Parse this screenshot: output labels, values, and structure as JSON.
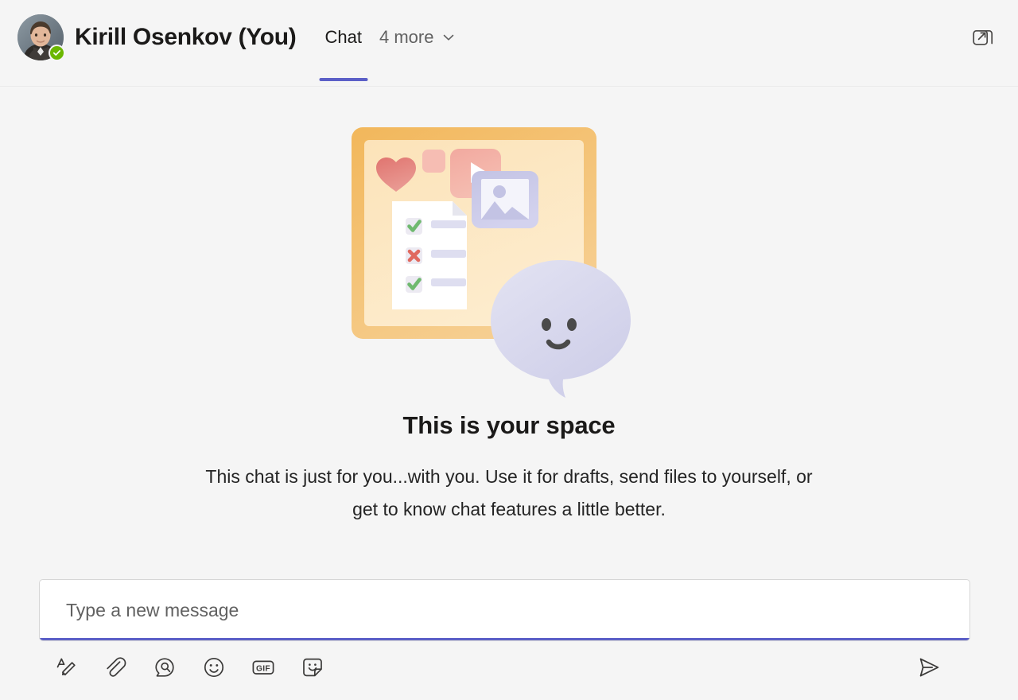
{
  "header": {
    "chat_title": "Kirill Osenkov (You)",
    "avatar_name": "user-avatar",
    "presence_status": "available",
    "tabs": [
      {
        "label": "Chat",
        "active": true
      },
      {
        "label": "4 more",
        "active": false
      }
    ],
    "popout_label": "Pop out chat"
  },
  "empty_state": {
    "illustration_name": "your-space-illustration",
    "heading": "This is your space",
    "description": "This chat is just for you...with you. Use it for drafts, send files to yourself, or get to know chat features a little better."
  },
  "compose": {
    "placeholder": "Type a new message",
    "value": "",
    "tools": [
      {
        "name": "format-icon",
        "label": "Format"
      },
      {
        "name": "attach-icon",
        "label": "Attach"
      },
      {
        "name": "loop-components-icon",
        "label": "Loop components"
      },
      {
        "name": "emoji-icon",
        "label": "Emoji"
      },
      {
        "name": "gif-icon",
        "label": "GIF"
      },
      {
        "name": "sticker-icon",
        "label": "Sticker"
      }
    ],
    "gif_label": "GIF",
    "send_label": "Send"
  },
  "colors": {
    "accent": "#5b5fc7",
    "presence_available": "#6bb700",
    "background": "#f5f5f5",
    "board_frame": "#f0b357",
    "board_fill": "#fbe2b5",
    "heart": "#e4807c",
    "bubble": "#d2d2ea",
    "check_green": "#6bb36b",
    "cross_red": "#e0695f"
  }
}
